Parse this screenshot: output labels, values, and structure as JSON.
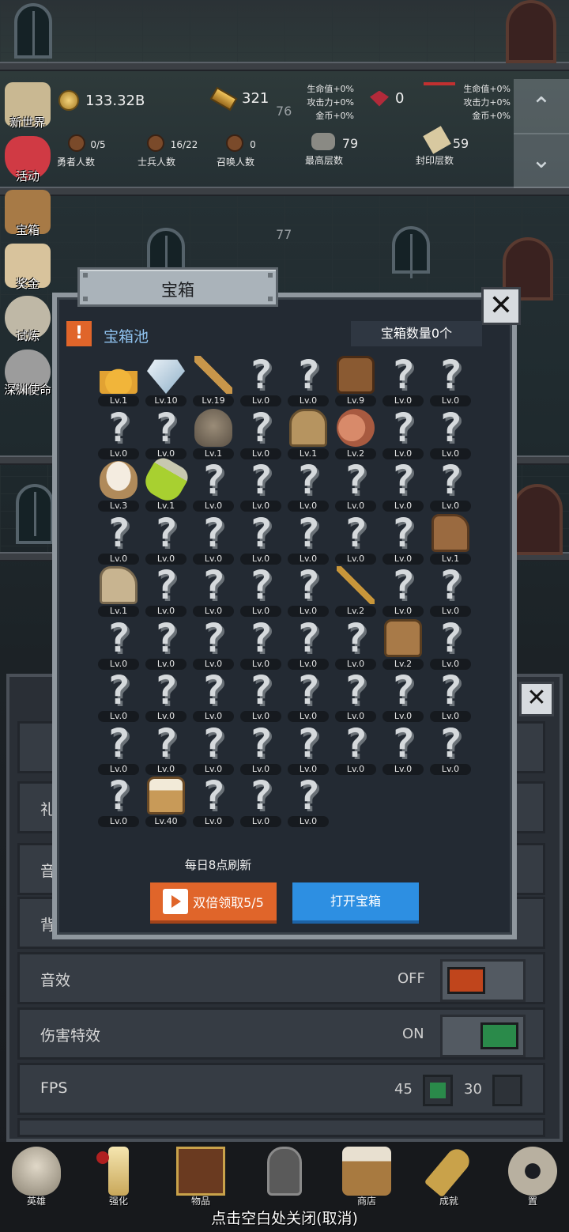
{
  "hud": {
    "gold": "133.32B",
    "bars": "321",
    "gems": "0",
    "floor_left": "76",
    "floor_mid": "77",
    "bonus_left": [
      "生命值+0%",
      "攻击力+0%",
      "金币+0%"
    ],
    "bonus_right": [
      "生命值+0%",
      "攻击力+0%",
      "金币+0%"
    ],
    "counters": [
      {
        "value": "0/5",
        "label": "勇者人数"
      },
      {
        "value": "16/22",
        "label": "士兵人数"
      },
      {
        "value": "0",
        "label": "召唤人数"
      },
      {
        "value": "79",
        "label": "最高层数"
      },
      {
        "value": "59",
        "label": "封印层数"
      }
    ]
  },
  "side_menu": [
    "新世界",
    "活动",
    "宝箱",
    "奖金",
    "试炼",
    "深渊使命"
  ],
  "settings": {
    "rows": [
      {
        "label": "礼"
      },
      {
        "label": "音"
      },
      {
        "label": "背"
      },
      {
        "label": "音效",
        "value": "OFF",
        "color": "#c0451c"
      },
      {
        "label": "伤害特效",
        "value": "ON",
        "color": "#2a8a4a"
      },
      {
        "label": "FPS",
        "opt1": "45",
        "opt2": "30"
      }
    ]
  },
  "dialog": {
    "title": "宝箱",
    "pool_title": "宝箱池",
    "count_text": "宝箱数量0个",
    "refresh_text": "每日8点刷新",
    "double_button": "双倍领取5/5",
    "open_button": "打开宝箱",
    "items": [
      {
        "icon": "crown-icon",
        "lv": "Lv.1"
      },
      {
        "icon": "diamond-icon",
        "lv": "Lv.10"
      },
      {
        "icon": "sword-icon",
        "lv": "Lv.19"
      },
      {
        "icon": "unknown-icon",
        "lv": "Lv.0"
      },
      {
        "icon": "unknown-icon",
        "lv": "Lv.0"
      },
      {
        "icon": "armor-icon",
        "lv": "Lv.9"
      },
      {
        "icon": "unknown-icon",
        "lv": "Lv.0"
      },
      {
        "icon": "unknown-icon",
        "lv": "Lv.0"
      },
      {
        "icon": "unknown-icon",
        "lv": "Lv.0"
      },
      {
        "icon": "unknown-icon",
        "lv": "Lv.0"
      },
      {
        "icon": "helmet-icon",
        "lv": "Lv.1"
      },
      {
        "icon": "unknown-icon",
        "lv": "Lv.0"
      },
      {
        "icon": "knight-helm-icon",
        "lv": "Lv.1"
      },
      {
        "icon": "meat-icon",
        "lv": "Lv.2"
      },
      {
        "icon": "unknown-icon",
        "lv": "Lv.0"
      },
      {
        "icon": "unknown-icon",
        "lv": "Lv.0"
      },
      {
        "icon": "bowl-icon",
        "lv": "Lv.3"
      },
      {
        "icon": "potion-icon",
        "lv": "Lv.1"
      },
      {
        "icon": "unknown-icon",
        "lv": "Lv.0"
      },
      {
        "icon": "unknown-icon",
        "lv": "Lv.0"
      },
      {
        "icon": "unknown-icon",
        "lv": "Lv.0"
      },
      {
        "icon": "unknown-icon",
        "lv": "Lv.0"
      },
      {
        "icon": "unknown-icon",
        "lv": "Lv.0"
      },
      {
        "icon": "unknown-icon",
        "lv": "Lv.0"
      },
      {
        "icon": "unknown-icon",
        "lv": "Lv.0"
      },
      {
        "icon": "unknown-icon",
        "lv": "Lv.0"
      },
      {
        "icon": "unknown-icon",
        "lv": "Lv.0"
      },
      {
        "icon": "unknown-icon",
        "lv": "Lv.0"
      },
      {
        "icon": "unknown-icon",
        "lv": "Lv.0"
      },
      {
        "icon": "unknown-icon",
        "lv": "Lv.0"
      },
      {
        "icon": "unknown-icon",
        "lv": "Lv.0"
      },
      {
        "icon": "boot-icon",
        "lv": "Lv.1"
      },
      {
        "icon": "shoe-icon",
        "lv": "Lv.1"
      },
      {
        "icon": "unknown-icon",
        "lv": "Lv.0"
      },
      {
        "icon": "unknown-icon",
        "lv": "Lv.0"
      },
      {
        "icon": "unknown-icon",
        "lv": "Lv.0"
      },
      {
        "icon": "unknown-icon",
        "lv": "Lv.0"
      },
      {
        "icon": "torch-icon",
        "lv": "Lv.2"
      },
      {
        "icon": "unknown-icon",
        "lv": "Lv.0"
      },
      {
        "icon": "unknown-icon",
        "lv": "Lv.0"
      },
      {
        "icon": "unknown-icon",
        "lv": "Lv.0"
      },
      {
        "icon": "unknown-icon",
        "lv": "Lv.0"
      },
      {
        "icon": "unknown-icon",
        "lv": "Lv.0"
      },
      {
        "icon": "unknown-icon",
        "lv": "Lv.0"
      },
      {
        "icon": "unknown-icon",
        "lv": "Lv.0"
      },
      {
        "icon": "unknown-icon",
        "lv": "Lv.0"
      },
      {
        "icon": "backpack-icon",
        "lv": "Lv.2"
      },
      {
        "icon": "unknown-icon",
        "lv": "Lv.0"
      },
      {
        "icon": "unknown-icon",
        "lv": "Lv.0"
      },
      {
        "icon": "unknown-icon",
        "lv": "Lv.0"
      },
      {
        "icon": "unknown-icon",
        "lv": "Lv.0"
      },
      {
        "icon": "unknown-icon",
        "lv": "Lv.0"
      },
      {
        "icon": "unknown-icon",
        "lv": "Lv.0"
      },
      {
        "icon": "unknown-icon",
        "lv": "Lv.0"
      },
      {
        "icon": "unknown-icon",
        "lv": "Lv.0"
      },
      {
        "icon": "unknown-icon",
        "lv": "Lv.0"
      },
      {
        "icon": "unknown-icon",
        "lv": "Lv.0"
      },
      {
        "icon": "unknown-icon",
        "lv": "Lv.0"
      },
      {
        "icon": "unknown-icon",
        "lv": "Lv.0"
      },
      {
        "icon": "unknown-icon",
        "lv": "Lv.0"
      },
      {
        "icon": "unknown-icon",
        "lv": "Lv.0"
      },
      {
        "icon": "unknown-icon",
        "lv": "Lv.0"
      },
      {
        "icon": "unknown-icon",
        "lv": "Lv.0"
      },
      {
        "icon": "unknown-icon",
        "lv": "Lv.0"
      },
      {
        "icon": "unknown-icon",
        "lv": "Lv.0"
      },
      {
        "icon": "beer-mug-icon",
        "lv": "Lv.40"
      },
      {
        "icon": "unknown-icon",
        "lv": "Lv.0"
      },
      {
        "icon": "unknown-icon",
        "lv": "Lv.0"
      },
      {
        "icon": "unknown-icon",
        "lv": "Lv.0"
      }
    ]
  },
  "bottom_nav": [
    "英雄",
    "强化",
    "物品",
    "",
    "商店",
    "成就",
    "置"
  ],
  "close_hint": "点击空白处关闭(取消)"
}
